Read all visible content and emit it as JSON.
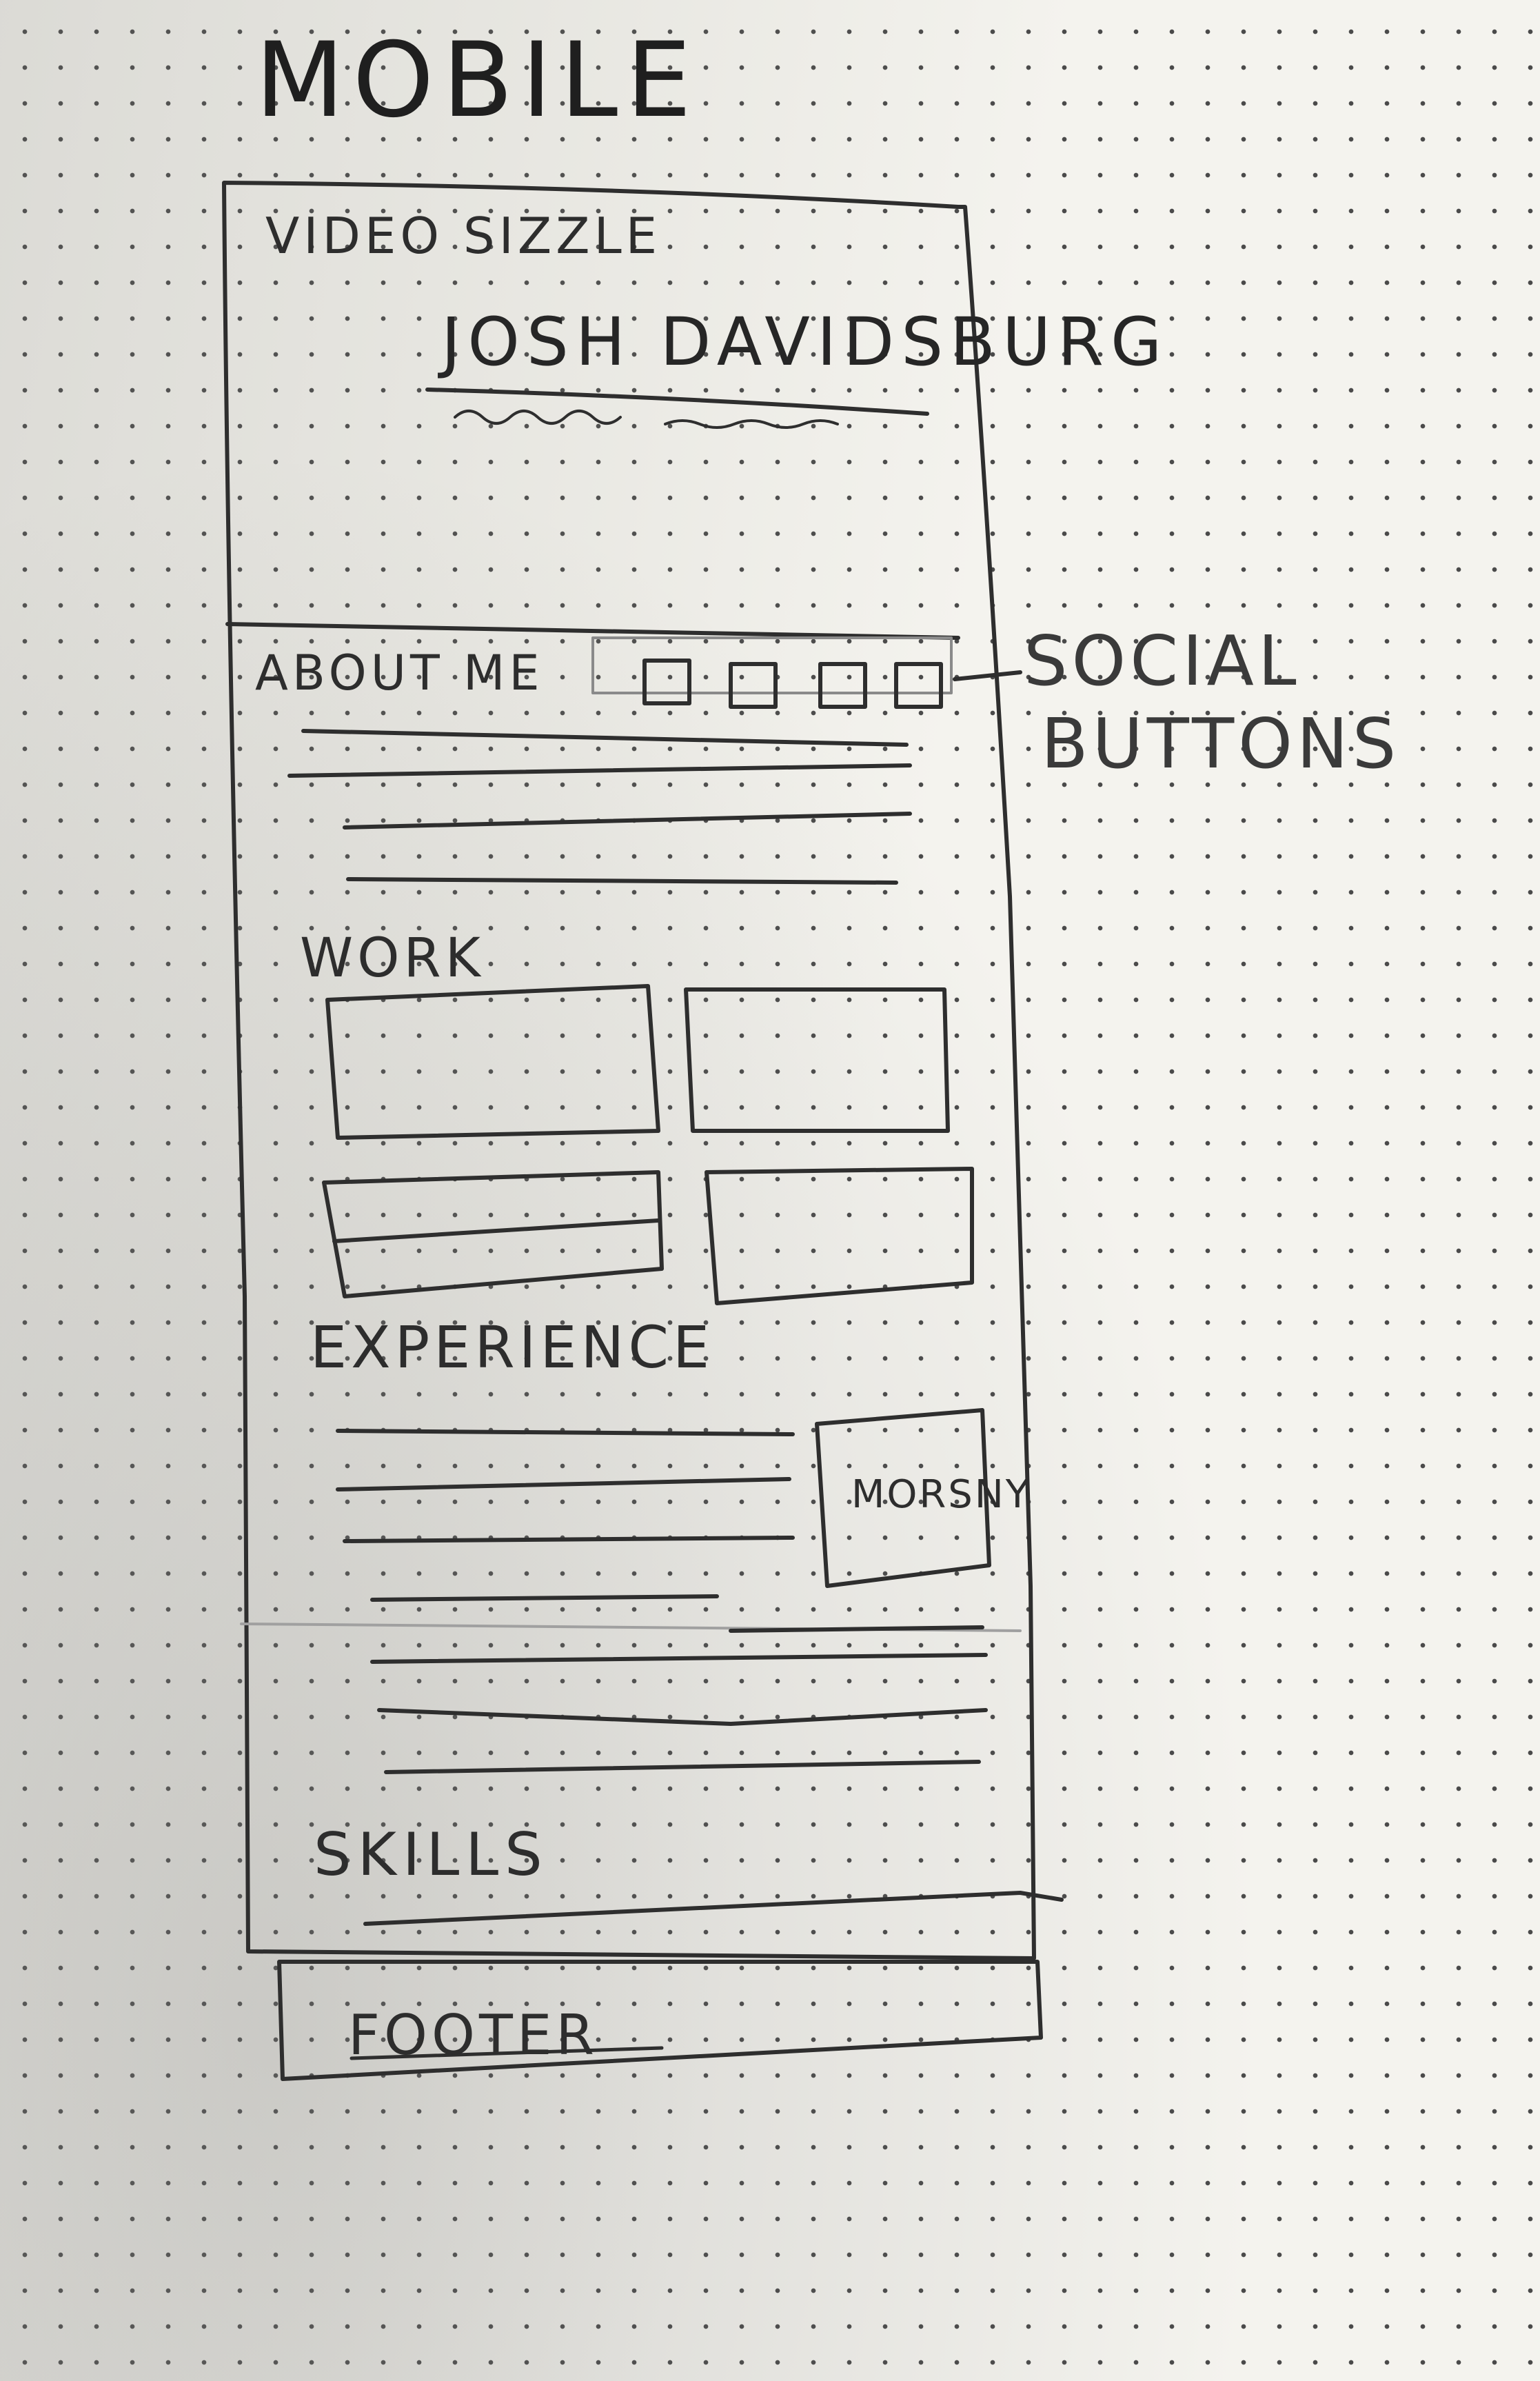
{
  "page_title": "MOBILE",
  "hero": {
    "label": "VIDEO SIZZLE",
    "name": "JOSH DAVIDSBURG"
  },
  "about": {
    "label": "ABOUT ME",
    "social_note_line1": "SOCIAL",
    "social_note_line2": "BUTTONS"
  },
  "work": {
    "label": "WORK"
  },
  "experience": {
    "label": "EXPERIENCE",
    "image_label": "MORSNY"
  },
  "skills": {
    "label": "SKILLS"
  },
  "footer": {
    "label": "FOOTER"
  }
}
